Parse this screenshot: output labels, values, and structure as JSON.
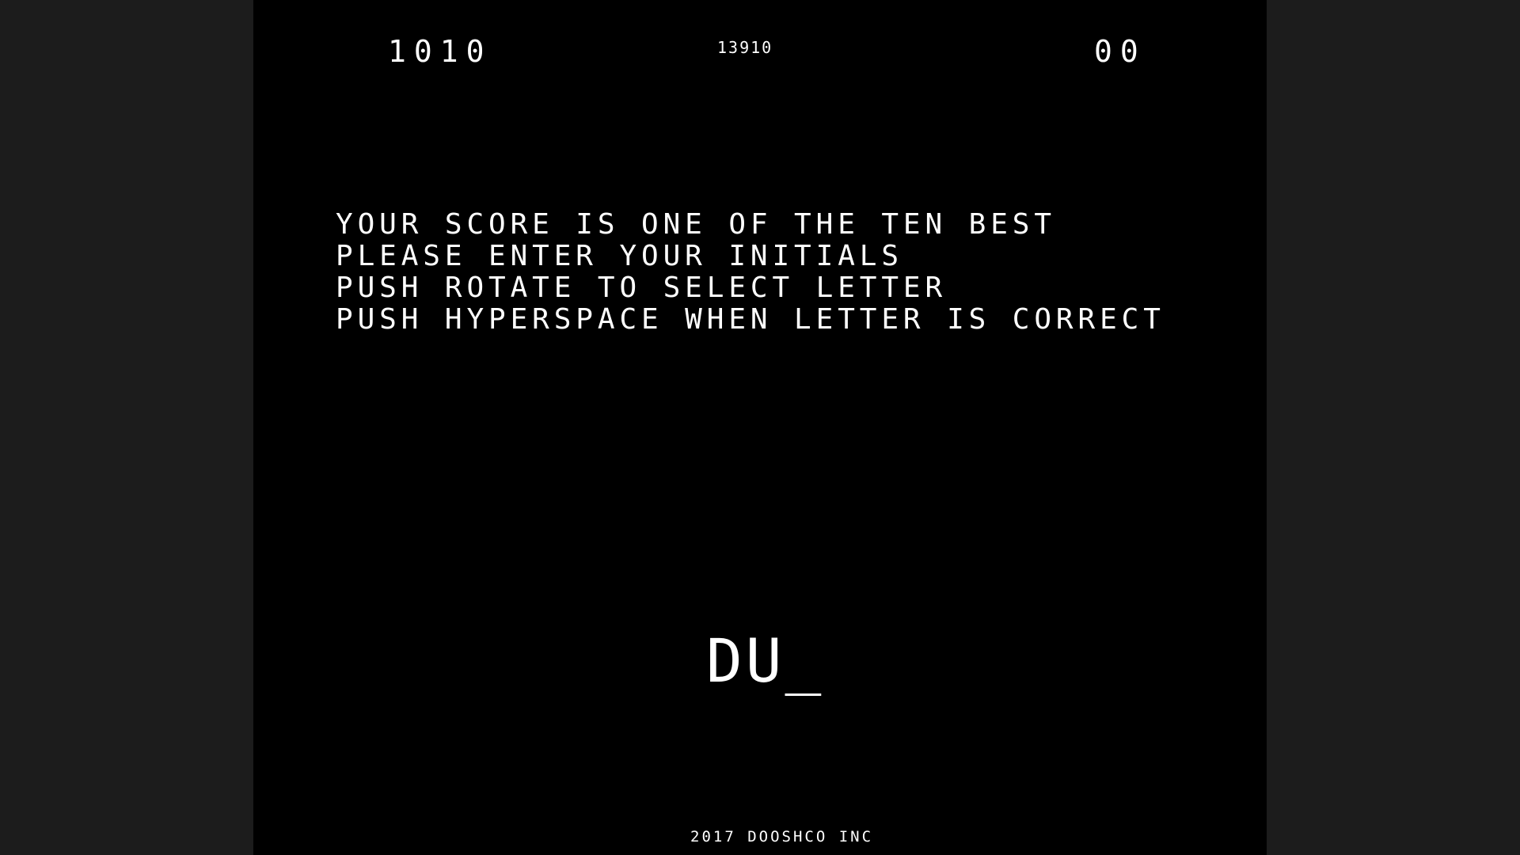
{
  "hud": {
    "player1_score": "1010",
    "high_score": "13910",
    "player2_score": "00"
  },
  "messages": [
    "YOUR SCORE IS ONE OF THE TEN BEST",
    "PLEASE ENTER YOUR INITIALS",
    "PUSH ROTATE TO SELECT LETTER",
    "PUSH HYPERSPACE WHEN LETTER IS CORRECT"
  ],
  "initials_entry": "DU_",
  "footer": {
    "copyright": "2017 DOOSHCO INC"
  },
  "colors": {
    "screen_background": "#000000",
    "outer_background": "#1c1c1c",
    "vector_text": "#ffffff"
  }
}
